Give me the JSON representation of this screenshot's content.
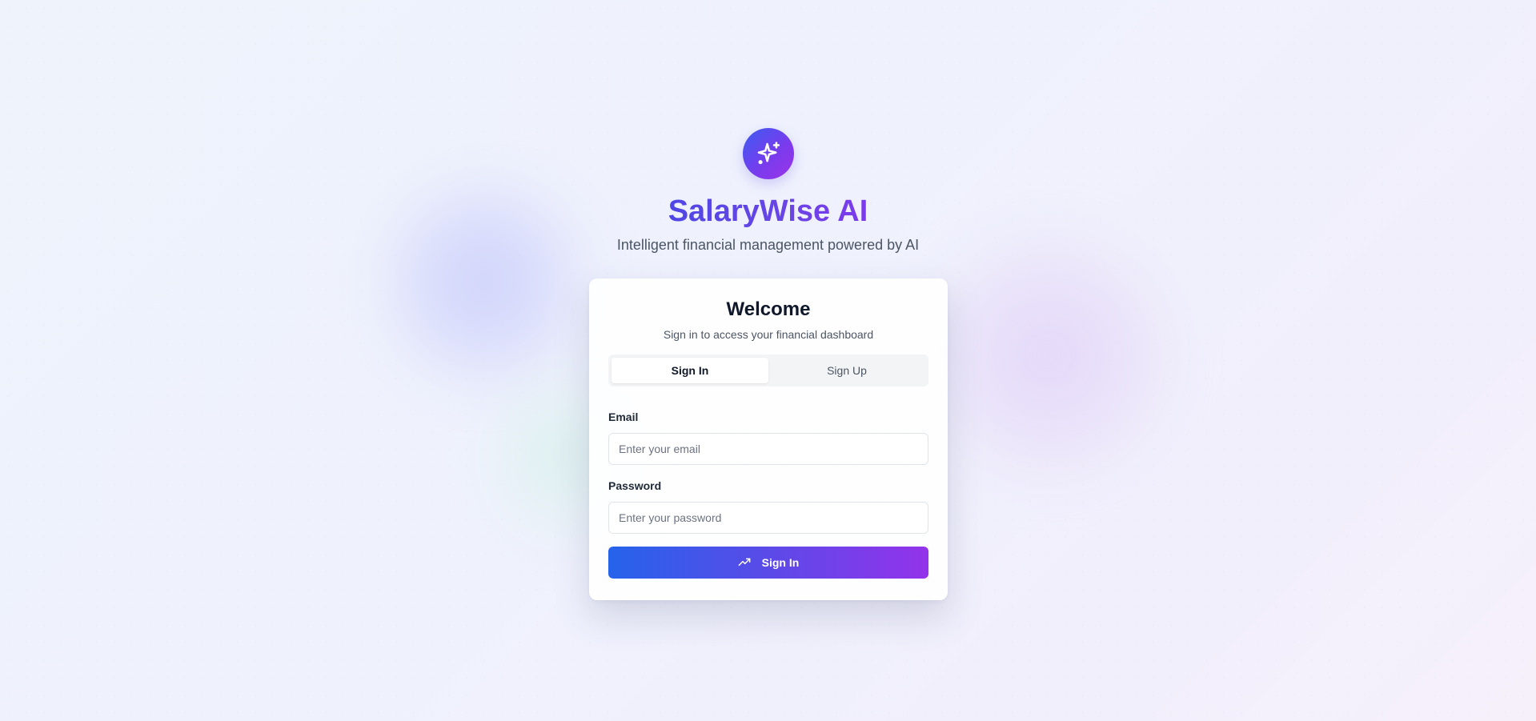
{
  "app": {
    "title": "SalaryWise AI",
    "tagline": "Intelligent financial management powered by AI",
    "logo_icon": "sparkles-icon"
  },
  "card": {
    "heading": "Welcome",
    "subheading": "Sign in to access your financial dashboard",
    "tabs": [
      {
        "label": "Sign In",
        "active": true
      },
      {
        "label": "Sign Up",
        "active": false
      }
    ],
    "email": {
      "label": "Email",
      "placeholder": "Enter your email",
      "value": ""
    },
    "password": {
      "label": "Password",
      "placeholder": "Enter your password",
      "value": ""
    },
    "submit": {
      "label": "Sign In",
      "icon": "trending-up-icon"
    }
  },
  "colors": {
    "accent_blue": "#2563eb",
    "accent_purple": "#9333ea",
    "title_indigo": "#4f46e5"
  }
}
